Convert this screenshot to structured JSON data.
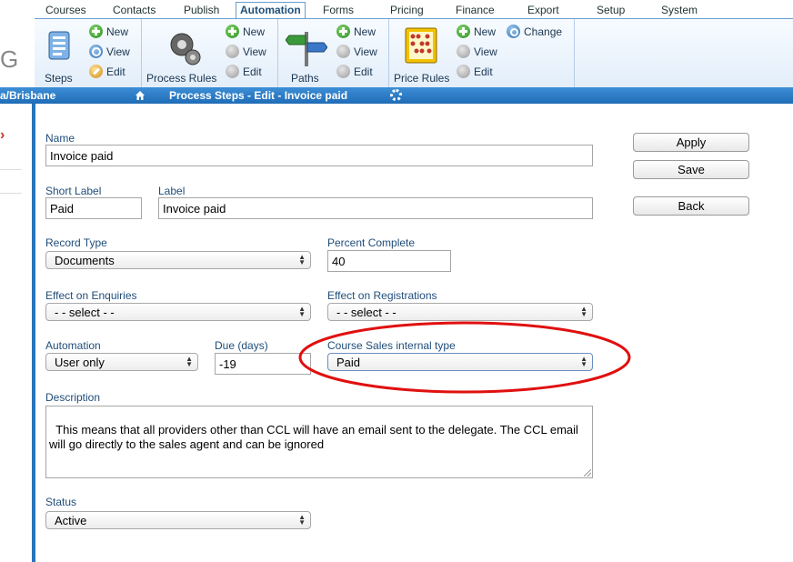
{
  "menu": {
    "items": [
      "Courses",
      "Contacts",
      "Publish",
      "Automation",
      "Forms",
      "Pricing",
      "Finance",
      "Export",
      "Setup",
      "System"
    ],
    "active": "Automation"
  },
  "ribbon": {
    "steps": {
      "label": "Steps",
      "new": "New",
      "view": "View",
      "edit": "Edit"
    },
    "process_rules": {
      "label": "Process Rules",
      "new": "New",
      "view": "View",
      "edit": "Edit"
    },
    "paths": {
      "label": "Paths",
      "new": "New",
      "view": "View",
      "edit": "Edit"
    },
    "price_rules": {
      "label": "Price Rules",
      "new": "New",
      "view": "View",
      "edit": "Edit",
      "change": "Change"
    }
  },
  "left": {
    "logo_fragment": "G",
    "location": "a/Brisbane"
  },
  "titlebar": {
    "title": "Process Steps - Edit - Invoice paid"
  },
  "form": {
    "name": {
      "label": "Name",
      "value": "Invoice paid"
    },
    "short_label": {
      "label": "Short Label",
      "value": "Paid"
    },
    "label": {
      "label": "Label",
      "value": "Invoice paid"
    },
    "record_type": {
      "label": "Record Type",
      "value": "Documents"
    },
    "percent_complete": {
      "label": "Percent Complete",
      "value": "40"
    },
    "effect_enquiries": {
      "label": "Effect on Enquiries",
      "value": "- - select - -"
    },
    "effect_registrations": {
      "label": "Effect on Registrations",
      "value": "- - select - -"
    },
    "automation": {
      "label": "Automation",
      "value": "User only"
    },
    "due_days": {
      "label": "Due (days)",
      "value": "-19"
    },
    "course_sales_type": {
      "label": "Course Sales internal type",
      "value": "Paid"
    },
    "description": {
      "label": "Description",
      "value": "This means that all providers other than CCL will have an email sent to the delegate. The CCL email will go directly to the sales agent and can be ignored"
    },
    "status": {
      "label": "Status",
      "value": "Active"
    }
  },
  "buttons": {
    "apply": "Apply",
    "save": "Save",
    "back": "Back"
  },
  "colors": {
    "accent": "#2a74bb",
    "highlight": "#e01010",
    "label_text": "#1f4d7a"
  }
}
